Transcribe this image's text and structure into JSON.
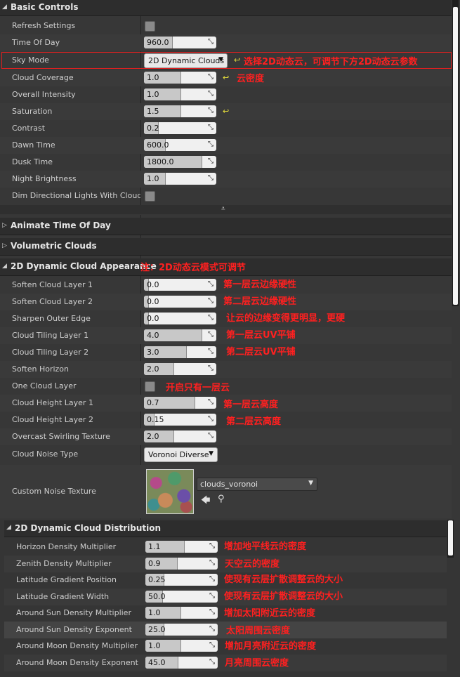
{
  "sections": {
    "basic": "Basic Controls",
    "animate": "Animate Time Of Day",
    "volumetric": "Volumetric Clouds",
    "appearance": "2D Dynamic Cloud Appearance",
    "distribution": "2D Dynamic Cloud Distribution"
  },
  "basic": {
    "refresh": "Refresh Settings",
    "time_of_day": {
      "label": "Time Of Day",
      "value": "960.0"
    },
    "sky_mode": {
      "label": "Sky Mode",
      "value": "2D Dynamic Clouds"
    },
    "cloud_coverage": {
      "label": "Cloud Coverage",
      "value": "1.0"
    },
    "overall_intensity": {
      "label": "Overall Intensity",
      "value": "1.0"
    },
    "saturation": {
      "label": "Saturation",
      "value": "1.5"
    },
    "contrast": {
      "label": "Contrast",
      "value": "0.2"
    },
    "dawn_time": {
      "label": "Dawn Time",
      "value": "600.0"
    },
    "dusk_time": {
      "label": "Dusk Time",
      "value": "1800.0"
    },
    "night_brightness": {
      "label": "Night Brightness",
      "value": "1.0"
    },
    "dim_lights": "Dim Directional Lights With Cloud Cov"
  },
  "appearance": {
    "soften1": {
      "label": "Soften Cloud Layer 1",
      "value": "0.0"
    },
    "soften2": {
      "label": "Soften Cloud Layer 2",
      "value": "0.0"
    },
    "sharpen": {
      "label": "Sharpen Outer Edge",
      "value": "0.0"
    },
    "tiling1": {
      "label": "Cloud Tiling Layer 1",
      "value": "4.0"
    },
    "tiling2": {
      "label": "Cloud Tiling Layer 2",
      "value": "3.0"
    },
    "soften_horizon": {
      "label": "Soften Horizon",
      "value": "2.0"
    },
    "one_layer": "One Cloud Layer",
    "height1": {
      "label": "Cloud Height Layer 1",
      "value": "0.7"
    },
    "height2": {
      "label": "Cloud Height Layer 2",
      "value": "0.15"
    },
    "overcast": {
      "label": "Overcast Swirling Texture",
      "value": "2.0"
    },
    "noise_type": {
      "label": "Cloud Noise Type",
      "value": "Voronoi Diverse"
    },
    "custom_noise": {
      "label": "Custom Noise Texture",
      "asset": "clouds_voronoi"
    }
  },
  "distribution": {
    "horizon": {
      "label": "Horizon Density Multiplier",
      "value": "1.1"
    },
    "zenith": {
      "label": "Zenith Density Multiplier",
      "value": "0.9"
    },
    "lat_pos": {
      "label": "Latitude Gradient Position",
      "value": "0.25"
    },
    "lat_width": {
      "label": "Latitude Gradient Width",
      "value": "50.0"
    },
    "sun_mult": {
      "label": "Around Sun Density Multiplier",
      "value": "1.0"
    },
    "sun_exp": {
      "label": "Around Sun Density Exponent",
      "value": "25.0"
    },
    "moon_mult": {
      "label": "Around Moon Density Multiplier",
      "value": "1.0"
    },
    "moon_exp": {
      "label": "Around Moon Density Exponent",
      "value": "45.0"
    }
  },
  "notes": {
    "sky_mode": "选择2D动态云，可调节下方2D动态云参数",
    "coverage": "云密度",
    "appearance": "注：2D动态云模式可调节",
    "soften1": "第一层云边缘硬性",
    "soften2": "第二层云边缘硬性",
    "sharpen": "让云的边缘变得更明显，更硬",
    "tiling1": "第一层云UV平铺",
    "tiling2": "第二层云UV平铺",
    "one_layer": "开启只有一层云",
    "height1": "第一层云高度",
    "height2": "第二层云高度",
    "horizon": "增加地平线云的密度",
    "zenith": "天空云的密度",
    "lat_pos": "使现有云层扩散调整云的大小",
    "lat_width": "使现有云层扩散调整云的大小",
    "sun_mult": "增加太阳附近云的密度",
    "sun_exp": "太阳周围云密度",
    "moon_mult": "增加月亮附近云的密度",
    "moon_exp": "月亮周围云密度"
  },
  "colors": {
    "annotation": "#ff2020",
    "accent": "#e8e03a"
  }
}
